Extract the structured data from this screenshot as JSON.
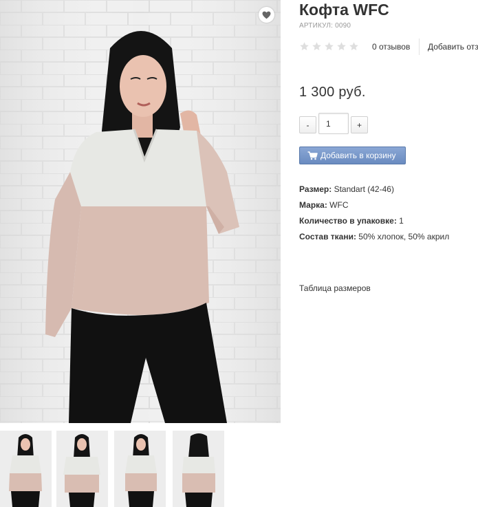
{
  "product": {
    "title": "Кофта WFC",
    "sku": "АРТИКУЛ: 0090",
    "rating": {
      "value": 0,
      "max": 5
    },
    "reviews_label": "0 отзывов",
    "add_review_label": "Добавить отз",
    "price": "1 300 руб.",
    "quantity": {
      "minus_label": "-",
      "value": "1",
      "plus_label": "+"
    },
    "cart_button_label": "Добавить в корзину",
    "attributes": [
      {
        "key": "Размер:",
        "value": "Standart (42-46)"
      },
      {
        "key": "Марка:",
        "value": "WFC"
      },
      {
        "key": "Количество в упаковке:",
        "value": "1"
      },
      {
        "key": "Состав ткани:",
        "value": "50% хлопок, 50% акрил"
      }
    ],
    "size_chart_label": "Таблица размеров"
  },
  "icons": {
    "wishlist": "heart-icon",
    "cart": "shopping-cart-icon",
    "rating": "star-icon"
  },
  "colors": {
    "cart_button": "#7393c8",
    "star_empty": "#dedede",
    "sweater_top": "#e6e7e3",
    "sweater_bottom": "#d9bdb2",
    "brick_wall": "#eeeeee"
  }
}
